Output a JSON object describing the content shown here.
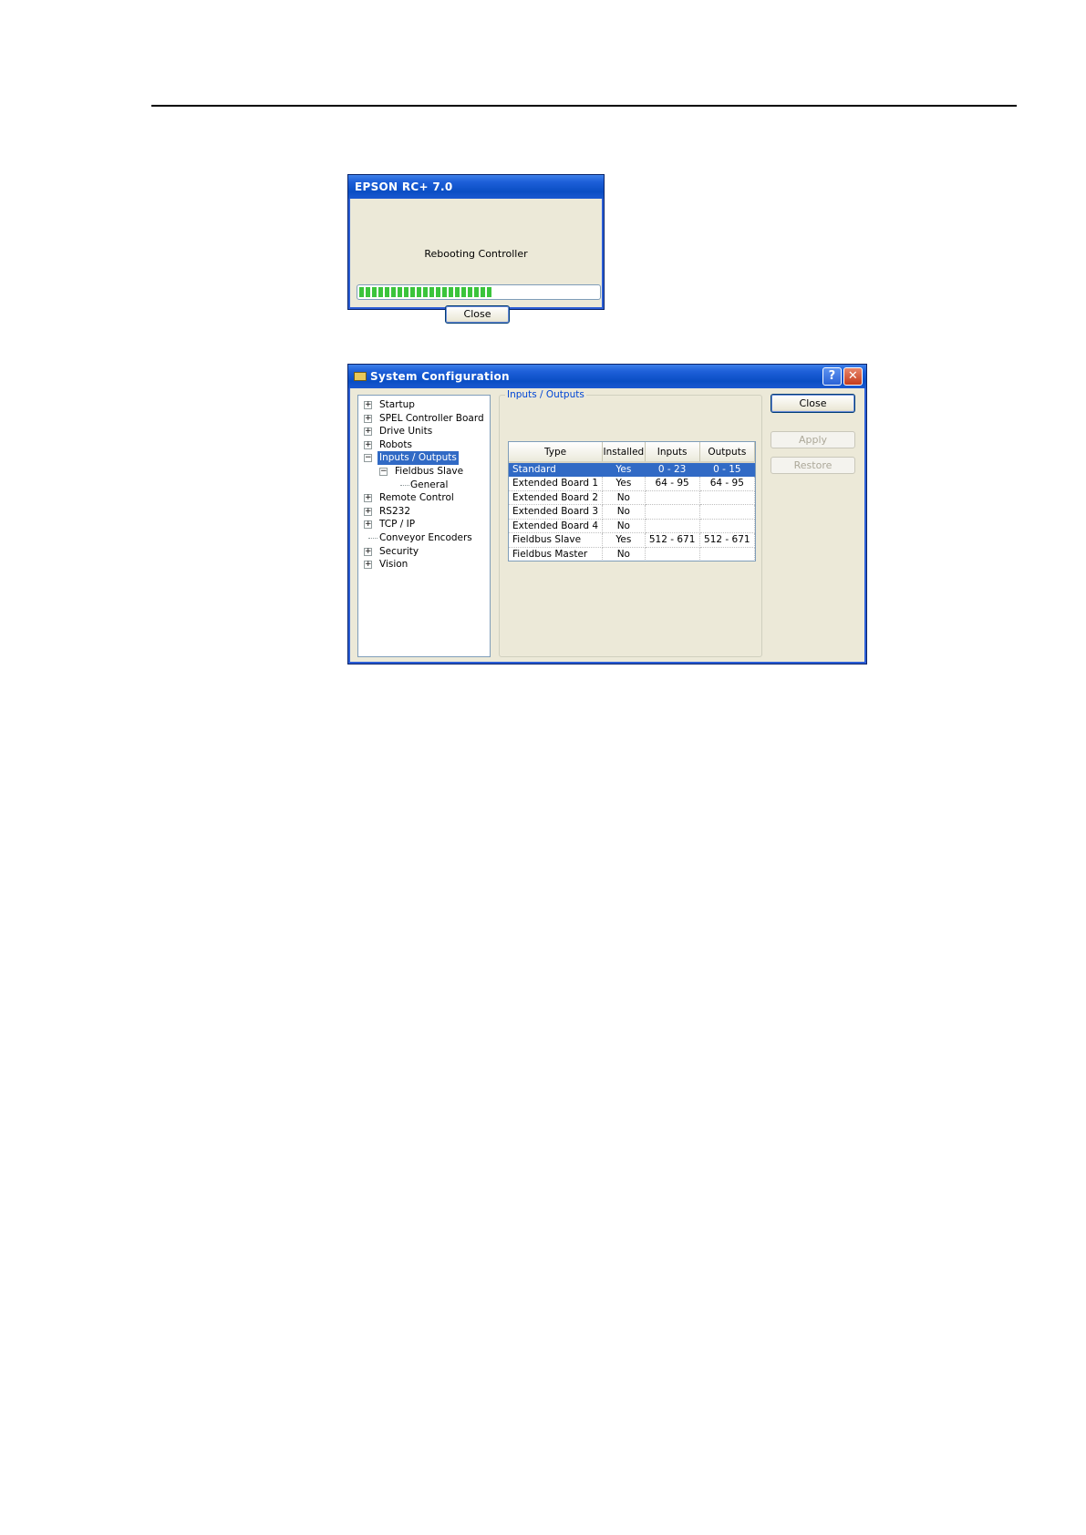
{
  "reboot_dialog": {
    "title": "EPSON RC+ 7.0",
    "message": "Rebooting Controller",
    "progress_percent": 56,
    "close_label": "Close"
  },
  "system_config": {
    "title": "System Configuration",
    "help_glyph": "?",
    "close_glyph": "✕",
    "tree": {
      "items": [
        {
          "label": "Startup"
        },
        {
          "label": "SPEL Controller Board"
        },
        {
          "label": "Drive Units"
        },
        {
          "label": "Robots"
        },
        {
          "label": "Inputs / Outputs"
        },
        {
          "label": "Fieldbus Slave"
        },
        {
          "label": "General"
        },
        {
          "label": "Remote Control"
        },
        {
          "label": "RS232"
        },
        {
          "label": "TCP / IP"
        },
        {
          "label": "Conveyor Encoders"
        },
        {
          "label": "Security"
        },
        {
          "label": "Vision"
        }
      ]
    },
    "group_title": "Inputs / Outputs",
    "table": {
      "headers": [
        "Type",
        "Installed",
        "Inputs",
        "Outputs"
      ],
      "rows": [
        {
          "type": "Standard",
          "installed": "Yes",
          "inputs": "0 - 23",
          "outputs": "0 - 15"
        },
        {
          "type": "Extended Board 1",
          "installed": "Yes",
          "inputs": "64 - 95",
          "outputs": "64 - 95"
        },
        {
          "type": "Extended Board 2",
          "installed": "No",
          "inputs": "",
          "outputs": ""
        },
        {
          "type": "Extended Board 3",
          "installed": "No",
          "inputs": "",
          "outputs": ""
        },
        {
          "type": "Extended Board 4",
          "installed": "No",
          "inputs": "",
          "outputs": ""
        },
        {
          "type": "Fieldbus Slave",
          "installed": "Yes",
          "inputs": "512 - 671",
          "outputs": "512 - 671"
        },
        {
          "type": "Fieldbus Master",
          "installed": "No",
          "inputs": "",
          "outputs": ""
        }
      ]
    },
    "buttons": {
      "close": "Close",
      "apply": "Apply",
      "restore": "Restore"
    }
  },
  "colors": {
    "title_bar": "#0a4ec4",
    "selection": "#316ac5",
    "progress": "#3bc43b",
    "dialog_bg": "#ece9d8"
  }
}
